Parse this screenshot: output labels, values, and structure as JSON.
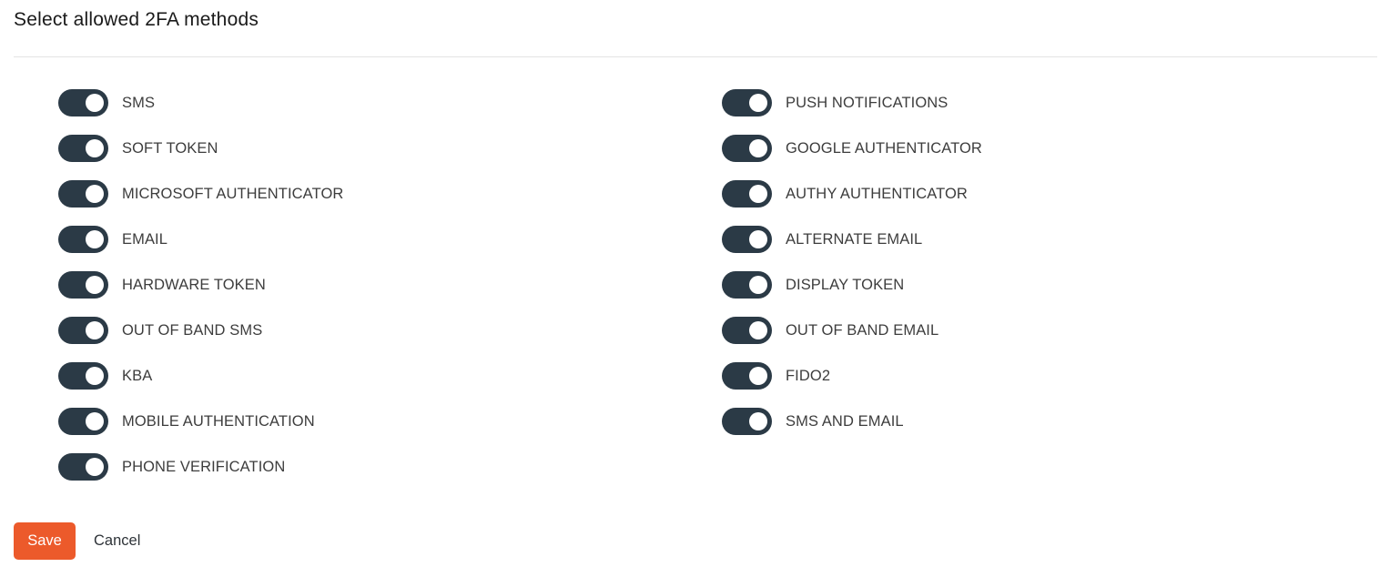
{
  "header": {
    "title": "Select allowed 2FA methods"
  },
  "colors": {
    "toggle_on": "#2b3a46",
    "toggle_knob": "#ffffff",
    "save_button": "#ec5a2b",
    "divider": "#e3e3e3"
  },
  "methods": {
    "left": [
      {
        "label": "SMS",
        "enabled": true
      },
      {
        "label": "SOFT TOKEN",
        "enabled": true
      },
      {
        "label": "MICROSOFT AUTHENTICATOR",
        "enabled": true
      },
      {
        "label": "EMAIL",
        "enabled": true
      },
      {
        "label": "HARDWARE TOKEN",
        "enabled": true
      },
      {
        "label": "OUT OF BAND SMS",
        "enabled": true
      },
      {
        "label": "KBA",
        "enabled": true
      },
      {
        "label": "MOBILE AUTHENTICATION",
        "enabled": true
      },
      {
        "label": "PHONE VERIFICATION",
        "enabled": true
      }
    ],
    "right": [
      {
        "label": "PUSH NOTIFICATIONS",
        "enabled": true
      },
      {
        "label": "GOOGLE AUTHENTICATOR",
        "enabled": true
      },
      {
        "label": "AUTHY AUTHENTICATOR",
        "enabled": true
      },
      {
        "label": "ALTERNATE EMAIL",
        "enabled": true
      },
      {
        "label": "DISPLAY TOKEN",
        "enabled": true
      },
      {
        "label": "OUT OF BAND EMAIL",
        "enabled": true
      },
      {
        "label": "FIDO2",
        "enabled": true
      },
      {
        "label": "SMS AND EMAIL",
        "enabled": true
      }
    ]
  },
  "actions": {
    "save_label": "Save",
    "cancel_label": "Cancel"
  }
}
